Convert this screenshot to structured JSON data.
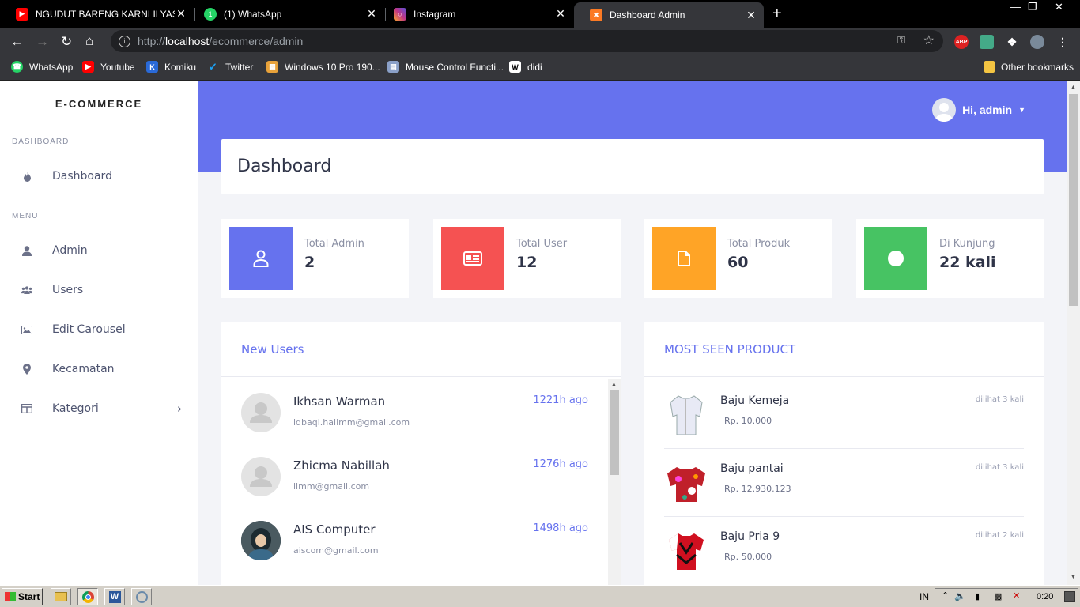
{
  "browser": {
    "tabs": [
      {
        "title": "NGUDUT BARENG KARNI ILYAS☐ (",
        "icon": "youtube-icon",
        "color": "#ff0000"
      },
      {
        "title": "(1) WhatsApp",
        "icon": "whatsapp-icon",
        "color": "#25d366"
      },
      {
        "title": "Instagram",
        "icon": "instagram-icon",
        "color": "#c13584"
      },
      {
        "title": "Dashboard Admin",
        "icon": "xampp-icon",
        "color": "#fb7a24"
      }
    ],
    "url_prefix": "http://",
    "url_host": "localhost",
    "url_path": "/ecommerce/admin",
    "extensions": [
      "ABP"
    ],
    "bookmarks": [
      {
        "label": "WhatsApp",
        "icon": "whatsapp-icon",
        "color": "#25d366"
      },
      {
        "label": "Youtube",
        "icon": "youtube-icon",
        "color": "#ff0000"
      },
      {
        "label": "Komiku",
        "icon": "komiku-icon",
        "color": "#2a6ad8",
        "glyph": "K"
      },
      {
        "label": "Twitter",
        "icon": "twitter-icon",
        "color": "#1da1f2"
      },
      {
        "label": "Windows 10 Pro 190...",
        "icon": "windows-icon",
        "color": "#e8a23a"
      },
      {
        "label": "Mouse Control Functi...",
        "icon": "doc-icon",
        "color": "#8aa0c8"
      },
      {
        "label": "didi",
        "icon": "wikipedia-icon",
        "color": "#ffffff",
        "glyph": "W"
      }
    ],
    "other_bookmarks": "Other bookmarks"
  },
  "sidebar": {
    "brand": "E-COMMERCE",
    "section_dashboard": "DASHBOARD",
    "section_menu": "MENU",
    "items": [
      {
        "label": "Dashboard",
        "icon": "fire-icon"
      },
      {
        "label": "Admin",
        "icon": "user-icon"
      },
      {
        "label": "Users",
        "icon": "users-icon"
      },
      {
        "label": "Edit Carousel",
        "icon": "image-icon"
      },
      {
        "label": "Kecamatan",
        "icon": "map-marker-icon"
      },
      {
        "label": "Kategori",
        "icon": "table-icon"
      }
    ]
  },
  "header": {
    "greeting": "Hi, admin"
  },
  "page_title": "Dashboard",
  "stats": [
    {
      "label": "Total Admin",
      "value": "2",
      "color": "#6672ee",
      "icon": "user-outline-icon"
    },
    {
      "label": "Total User",
      "value": "12",
      "color": "#f55252",
      "icon": "id-card-icon"
    },
    {
      "label": "Total Produk",
      "value": "60",
      "color": "#ffa426",
      "icon": "file-icon"
    },
    {
      "label": "Di Kunjung",
      "value": "22 kali",
      "color": "#47c363",
      "icon": "circle-icon"
    }
  ],
  "new_users": {
    "title": "New Users",
    "rows": [
      {
        "name": "Ikhsan Warman",
        "email": "iqbaqi.halimm@gmail.com",
        "ago": "1221h ago"
      },
      {
        "name": "Zhicma Nabillah",
        "email": "limm@gmail.com",
        "ago": "1276h ago"
      },
      {
        "name": "AIS Computer",
        "email": "aiscom@gmail.com",
        "ago": "1498h ago"
      }
    ]
  },
  "most_seen": {
    "title": "MOST SEEN PRODUCT",
    "rows": [
      {
        "name": "Baju Kemeja",
        "price": "Rp. 10.000",
        "seen": "dilihat 3 kali"
      },
      {
        "name": "Baju pantai",
        "price": "Rp. 12.930.123",
        "seen": "dilihat 3 kali"
      },
      {
        "name": "Baju Pria 9",
        "price": "Rp. 50.000",
        "seen": "dilihat 2 kali"
      }
    ]
  },
  "taskbar": {
    "start": "Start",
    "lang": "IN",
    "time": "0:20"
  }
}
